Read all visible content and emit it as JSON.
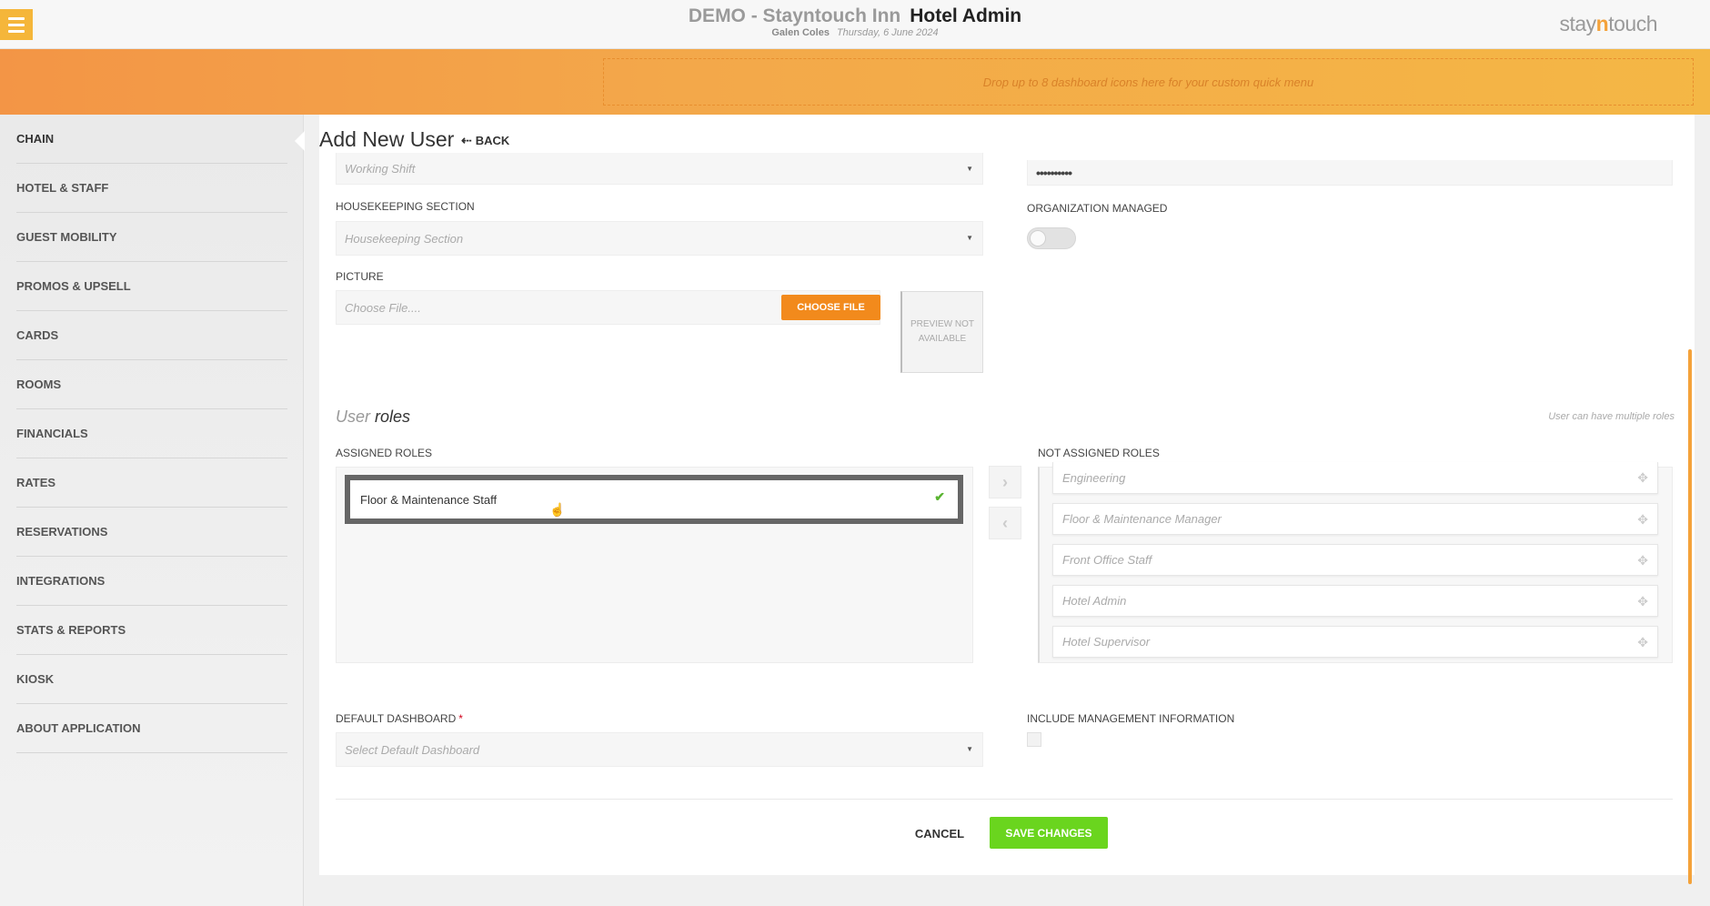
{
  "header": {
    "hotel_name": "DEMO - Stayntouch Inn",
    "module_name": "Hotel Admin",
    "user_name": "Galen Coles",
    "date": "Thursday, 6 June 2024",
    "logo_part1": "stay",
    "logo_part2": "n",
    "logo_part3": "touch",
    "menu_icon": "hamburger-icon"
  },
  "banner": {
    "dropzone_text": "Drop up to 8 dashboard icons here for your custom quick menu"
  },
  "sidebar": {
    "items": [
      {
        "label": "CHAIN",
        "active": true
      },
      {
        "label": "HOTEL & STAFF"
      },
      {
        "label": "GUEST MOBILITY"
      },
      {
        "label": "PROMOS & UPSELL"
      },
      {
        "label": "CARDS"
      },
      {
        "label": "ROOMS"
      },
      {
        "label": "FINANCIALS"
      },
      {
        "label": "RATES"
      },
      {
        "label": "RESERVATIONS"
      },
      {
        "label": "INTEGRATIONS"
      },
      {
        "label": "STATS & REPORTS"
      },
      {
        "label": "KIOSK"
      },
      {
        "label": "ABOUT APPLICATION"
      }
    ]
  },
  "page": {
    "title": "Add New User",
    "back_label": "BACK"
  },
  "form": {
    "working_shift_placeholder": "Working Shift",
    "password_value": "••••••••••",
    "housekeeping_label": "HOUSEKEEPING SECTION",
    "housekeeping_placeholder": "Housekeeping Section",
    "org_managed_label": "ORGANIZATION MANAGED",
    "org_managed_on": false,
    "picture_label": "PICTURE",
    "picture_placeholder": "Choose File....",
    "choose_file_label": "CHOOSE FILE",
    "preview_text": "PREVIEW NOT AVAILABLE"
  },
  "roles": {
    "title_light": "User",
    "title_strong": "roles",
    "hint": "User can have multiple roles",
    "assigned_label": "ASSIGNED ROLES",
    "not_assigned_label": "NOT ASSIGNED ROLES",
    "assigned": [
      "Floor & Maintenance Staff"
    ],
    "not_assigned": [
      "Engineering",
      "Floor & Maintenance Manager",
      "Front Office Staff",
      "Hotel Admin",
      "Hotel Supervisor"
    ]
  },
  "dashboard": {
    "label": "DEFAULT DASHBOARD",
    "required_mark": "*",
    "placeholder": "Select Default Dashboard",
    "include_mgmt_label": "INCLUDE MANAGEMENT INFORMATION"
  },
  "actions": {
    "cancel_label": "CANCEL",
    "save_label": "SAVE CHANGES"
  },
  "colors": {
    "accent_orange": "#f28a1c",
    "save_green": "#6ad51e",
    "menu_yellow": "#f5b63a"
  }
}
